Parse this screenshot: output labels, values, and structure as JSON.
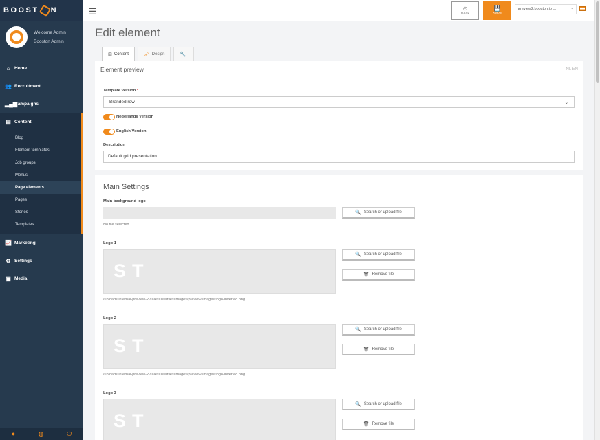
{
  "brand": {
    "logo_prefix": "BOOST",
    "logo_suffix": "N",
    "accent": "#f08a1c"
  },
  "user": {
    "welcome": "Welcome Admin",
    "name": "Booston Admin"
  },
  "nav": {
    "home": "Home",
    "recruitment": "Recruitment",
    "campaigns": "Campaigns",
    "content": "Content",
    "content_sub": [
      "Blog",
      "Element templates",
      "Job groups",
      "Menus",
      "Page elements",
      "Pages",
      "Stories",
      "Templates"
    ],
    "marketing": "Marketing",
    "settings": "Settings",
    "media": "Media"
  },
  "topbar": {
    "back_label": "Back",
    "save_label": "Save",
    "site_select": "preview2.booston.io ..."
  },
  "page": {
    "title": "Edit element"
  },
  "tabs": {
    "content": "Content",
    "design": "Design"
  },
  "preview": {
    "title": "Element preview",
    "languages": "NL  EN",
    "template_version_label": "Template version",
    "template_version_required": "*",
    "template_version_value": "Branded row",
    "nl_toggle": "Nederlands Version",
    "en_toggle": "English Version",
    "description_label": "Description",
    "description_value": "Default grid presentation"
  },
  "main_settings": {
    "title": "Main Settings",
    "bg_logo_label": "Main background logo",
    "no_file": "No file selected",
    "search_upload": "Search or upload file",
    "remove_file": "Remove file",
    "logo1_label": "Logo 1",
    "logo2_label": "Logo 2",
    "logo3_label": "Logo 3",
    "preview_letters": "ST",
    "logo_path": "/uploads/internal-preview-2-sales/userfiles/images/preview-images/logo-inverted.png"
  }
}
